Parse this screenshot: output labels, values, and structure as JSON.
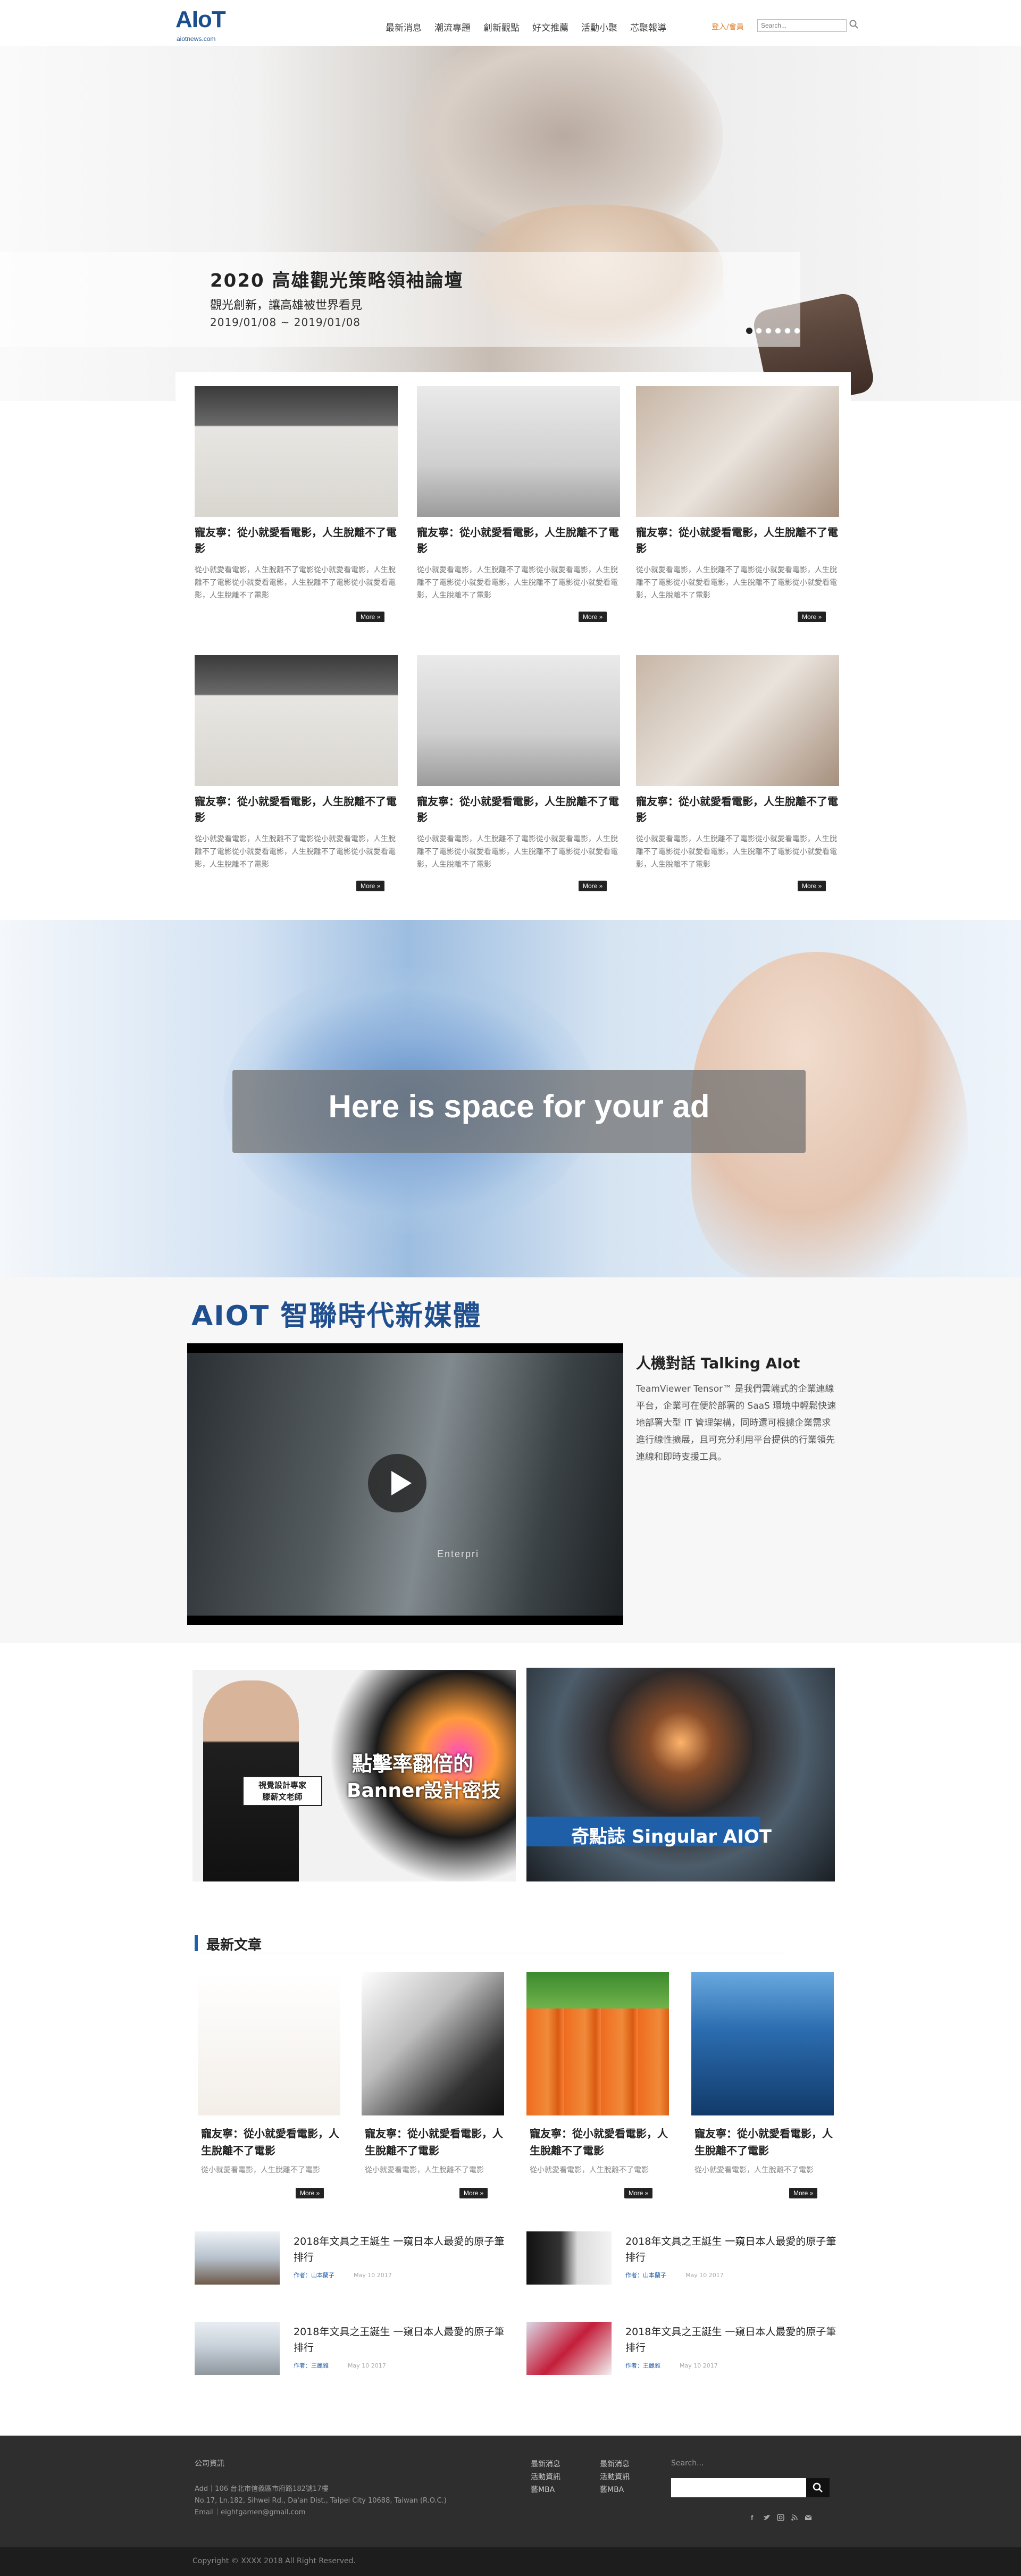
{
  "header": {
    "logo": "AIoT",
    "logo_sub": "aiotnews.com",
    "nav": [
      "最新消息",
      "潮流專題",
      "創新觀點",
      "好文推薦",
      "活動小聚",
      "芯聚報導"
    ],
    "login": "登入/會員",
    "search_placeholder": "Search..."
  },
  "facebook_tab": "facebook",
  "hero": {
    "title": "2020 高雄觀光策略領袖論壇",
    "subtitle": "觀光創新，讓高雄被世界看見",
    "date": "2019/01/08 ~ 2019/01/08",
    "slides": 6,
    "active_slide": 1
  },
  "cards": [
    {
      "title": "寵友寧：從小就愛看電影，人生脫離不了電影",
      "desc": "從小就愛看電影，人生脫離不了電影從小就愛看電影，人生脫離不了電影從小就愛看電影，人生脫離不了電影從小就愛看電影，人生脫離不了電影",
      "more": "More »"
    },
    {
      "title": "寵友寧：從小就愛看電影，人生脫離不了電影",
      "desc": "從小就愛看電影，人生脫離不了電影從小就愛看電影，人生脫離不了電影從小就愛看電影，人生脫離不了電影從小就愛看電影，人生脫離不了電影",
      "more": "More »"
    },
    {
      "title": "寵友寧：從小就愛看電影，人生脫離不了電影",
      "desc": "從小就愛看電影，人生脫離不了電影從小就愛看電影，人生脫離不了電影從小就愛看電影，人生脫離不了電影從小就愛看電影，人生脫離不了電影",
      "more": "More »"
    },
    {
      "title": "寵友寧：從小就愛看電影，人生脫離不了電影",
      "desc": "從小就愛看電影，人生脫離不了電影從小就愛看電影，人生脫離不了電影從小就愛看電影，人生脫離不了電影從小就愛看電影，人生脫離不了電影",
      "more": "More »"
    },
    {
      "title": "寵友寧：從小就愛看電影，人生脫離不了電影",
      "desc": "從小就愛看電影，人生脫離不了電影從小就愛看電影，人生脫離不了電影從小就愛看電影，人生脫離不了電影從小就愛看電影，人生脫離不了電影",
      "more": "More »"
    },
    {
      "title": "寵友寧：從小就愛看電影，人生脫離不了電影",
      "desc": "從小就愛看電影，人生脫離不了電影從小就愛看電影，人生脫離不了電影從小就愛看電影，人生脫離不了電影從小就愛看電影，人生脫離不了電影",
      "more": "More »"
    }
  ],
  "ad": {
    "text": "Here is space for your ad"
  },
  "media": {
    "title": "AIOT 智聯時代新媒體",
    "video_caption": "Enterpri",
    "side_title": "人機對話 Talking AIot",
    "side_text": "TeamViewer Tensor™ 是我們雲端式的企業連線平台，企業可在便於部署的 SaaS 環境中輕鬆快速地部署大型 IT 管理架構，同時還可根據企業需求進行線性擴展，且可充分利用平台提供的行業領先連線和即時支援工具。"
  },
  "promos": {
    "p1_line1": "點擊率翻倍的",
    "p1_line2": "Banner設計密技",
    "p1_badge_1": "視覺設計專家",
    "p1_badge_2": "滕薪文老師",
    "p2_label": "奇點誌 Singular AIOT"
  },
  "latest": {
    "heading": "最新文章",
    "cards": [
      {
        "title": "寵友寧：從小就愛看電影，人生脫離不了電影",
        "desc": "從小就愛看電影，人生脫離不了電影",
        "more": "More »"
      },
      {
        "title": "寵友寧：從小就愛看電影，人生脫離不了電影",
        "desc": "從小就愛看電影，人生脫離不了電影",
        "more": "More »"
      },
      {
        "title": "寵友寧：從小就愛看電影，人生脫離不了電影",
        "desc": "從小就愛看電影，人生脫離不了電影",
        "more": "More »"
      },
      {
        "title": "寵友寧：從小就愛看電影，人生脫離不了電影",
        "desc": "從小就愛看電影，人生脫離不了電影",
        "more": "More »"
      }
    ],
    "list": [
      {
        "title": "2018年文具之王誕生 一窺日本人最愛的原子筆排行",
        "author": "作者：山本蘭子",
        "date": "May 10 2017"
      },
      {
        "title": "2018年文具之王誕生 一窺日本人最愛的原子筆排行",
        "author": "作者：山本蘭子",
        "date": "May 10 2017"
      },
      {
        "title": "2018年文具之王誕生 一窺日本人最愛的原子筆排行",
        "author": "作者：王麗雅",
        "date": "May 10 2017"
      },
      {
        "title": "2018年文具之王誕生 一窺日本人最愛的原子筆排行",
        "author": "作者：王麗雅",
        "date": "May 10 2017"
      }
    ]
  },
  "footer": {
    "company_title": "公司資訊",
    "addr_1": "Add｜106 台北市信義區市府路182號17樓",
    "addr_2": "No.17, Ln.182, Sihwei Rd., Da'an Dist., Taipei City 10688, Taiwan (R.O.C.)",
    "email": "Email｜eightgamen@gmail.com",
    "links_col1": [
      "最新消息",
      "活動資訊",
      "藝MBA"
    ],
    "links_col2": [
      "最新消息",
      "活動資訊",
      "藝MBA"
    ],
    "search_label": "Search...",
    "copyright": "Copyright © XXXX 2018 All Right Reserved."
  }
}
